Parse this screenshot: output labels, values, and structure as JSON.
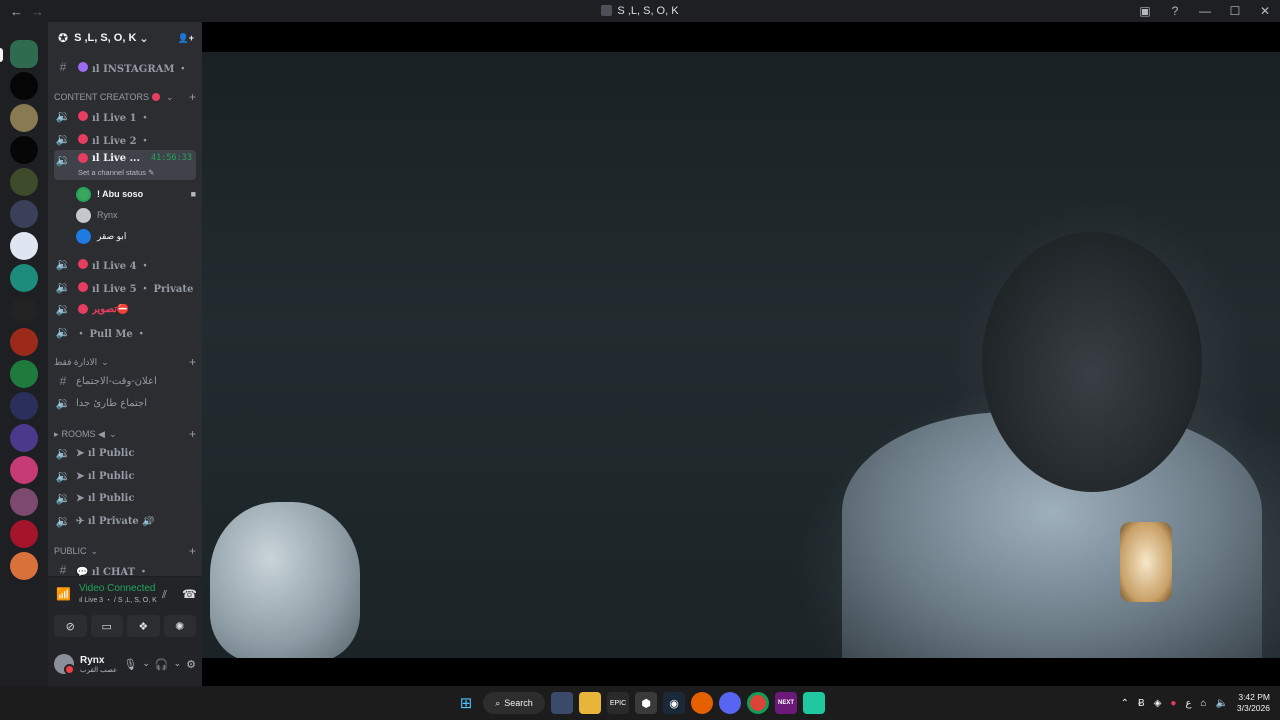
{
  "window": {
    "title": "S ,L, S, O, K",
    "back": "←",
    "forward": "→",
    "controls": [
      "▣",
      "?",
      "—",
      "☐",
      "✕"
    ]
  },
  "server": {
    "name": "S ,L, S, O, K",
    "invite_icon": "👤+"
  },
  "channels": {
    "instagram": "ıl INSTAGRAM ・",
    "cat_content": "CONTENT CREATORS",
    "live1": "ıl Live 1 ・",
    "live2": "ıl Live 2 ・",
    "live3": "ıl Live ...",
    "live3_timer": "41:56:33",
    "live3_hint": "Set a channel status",
    "users": [
      {
        "name": "! Abu soso",
        "color": "#3ba55d"
      },
      {
        "name": "Rynx",
        "color": "#c4c7ce"
      },
      {
        "name": "ابو صقر",
        "color": "#1e7be0"
      }
    ],
    "live4": "ıl Live 4 ・",
    "live5": "ıl Live 5 ・ Private",
    "photo": "تصوير⛔",
    "pullme": "・ Pull Me ・",
    "cat_admin": "الادارة فقط",
    "admin_announce": "اعلان-وقت-الاجتماع",
    "admin_meeting": "اجتماع طارئ جدا",
    "cat_rooms": "ROOMS ◀",
    "public1": "➤ ıl Public",
    "public2": "➤ ıl Public",
    "public3": "➤ ıl Public",
    "private": "✈ ıl Private 🔊",
    "cat_public": "PUBLIC",
    "chat": "💬 ıl CHAT ・"
  },
  "voice": {
    "status": "Video Connected",
    "location": "ıl Live 3 ・ / S ,L, S, O, K"
  },
  "user": {
    "name": "Rynx",
    "status": "عصب القرب"
  },
  "taskbar": {
    "search": "Search",
    "time": "3:42 PM",
    "date": "3/3/2026",
    "lang": "ع",
    "next": "NEXT"
  }
}
